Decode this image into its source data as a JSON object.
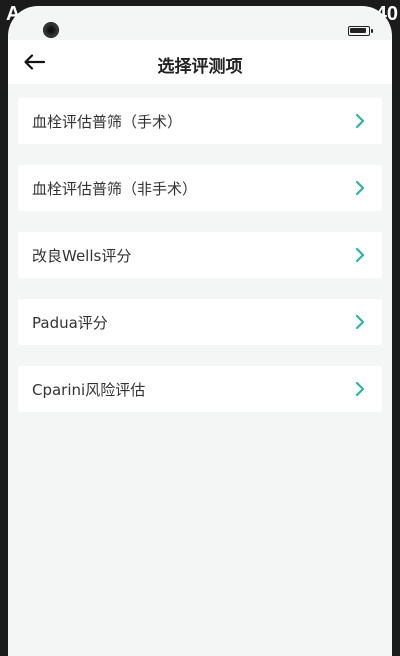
{
  "status_bar": {
    "left_text": "A",
    "right_text": "40"
  },
  "header": {
    "title": "选择评测项"
  },
  "items": [
    {
      "label": "血栓评估普筛（手术）"
    },
    {
      "label": "血栓评估普筛（非手术）"
    },
    {
      "label": "改良Wells评分"
    },
    {
      "label": "Padua评分"
    },
    {
      "label": "Cparini风险评估"
    }
  ],
  "colors": {
    "accent": "#2bb5a5",
    "background": "#f4f6f6",
    "card": "#ffffff",
    "text": "#333333"
  },
  "icons": [
    "back-arrow-icon",
    "chevron-right-icon",
    "camera-icon",
    "battery-icon"
  ]
}
